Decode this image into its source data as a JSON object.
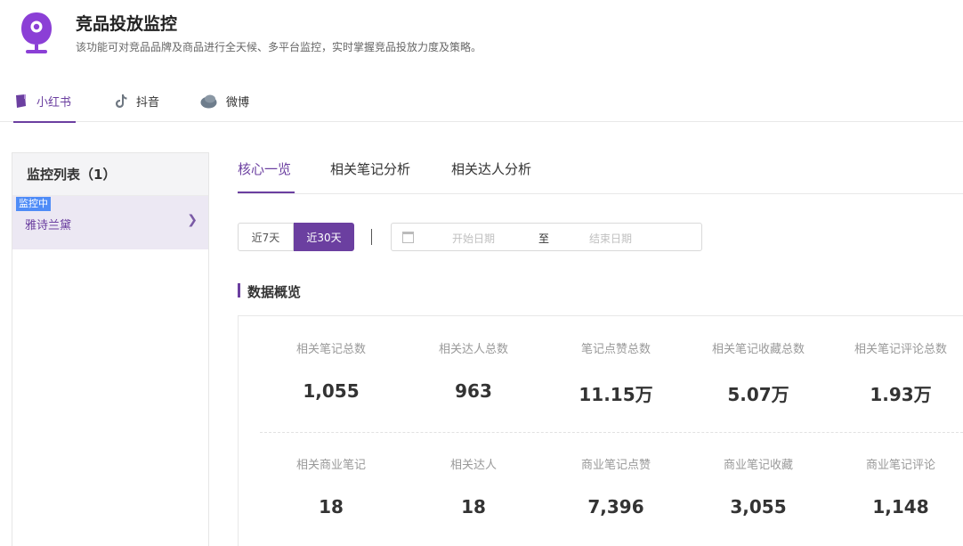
{
  "header": {
    "title": "竞品投放监控",
    "description": "该功能可对竞品品牌及商品进行全天候、多平台监控，实时掌握竞品投放力度及策略。"
  },
  "platform_tabs": [
    {
      "label": "小红书",
      "icon": "xiaohongshu-icon",
      "active": true
    },
    {
      "label": "抖音",
      "icon": "douyin-icon",
      "active": false
    },
    {
      "label": "微博",
      "icon": "weibo-icon",
      "active": false
    }
  ],
  "sidebar": {
    "title": "监控列表（1）",
    "items": [
      {
        "badge": "监控中",
        "name": "雅诗兰黛"
      }
    ]
  },
  "sub_tabs": [
    {
      "label": "核心一览",
      "active": true
    },
    {
      "label": "相关笔记分析",
      "active": false
    },
    {
      "label": "相关达人分析",
      "active": false
    }
  ],
  "filter": {
    "range_options": [
      {
        "label": "近7天",
        "active": false
      },
      {
        "label": "近30天",
        "active": true
      }
    ],
    "start_placeholder": "开始日期",
    "separator": "至",
    "end_placeholder": "结束日期"
  },
  "overview": {
    "title": "数据概览",
    "row1": [
      {
        "label": "相关笔记总数",
        "value": "1,055"
      },
      {
        "label": "相关达人总数",
        "value": "963"
      },
      {
        "label": "笔记点赞总数",
        "value": "11.15万"
      },
      {
        "label": "相关笔记收藏总数",
        "value": "5.07万"
      },
      {
        "label": "相关笔记评论总数",
        "value": "1.93万"
      }
    ],
    "row2": [
      {
        "label": "相关商业笔记",
        "value": "18"
      },
      {
        "label": "相关达人",
        "value": "18"
      },
      {
        "label": "商业笔记点赞",
        "value": "7,396"
      },
      {
        "label": "商业笔记收藏",
        "value": "3,055"
      },
      {
        "label": "商业笔记评论",
        "value": "1,148"
      }
    ]
  },
  "colors": {
    "accent": "#6b3fa0",
    "badge": "#4f8cf7",
    "selected_bg": "#ece8f3"
  }
}
